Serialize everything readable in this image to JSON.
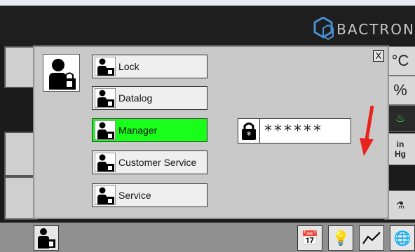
{
  "header": {
    "brand": "BACTRON"
  },
  "right_panel": {
    "temp_unit": "°C",
    "humidity_unit": "%",
    "pressure_unit_line1": "in",
    "pressure_unit_line2": "Hg"
  },
  "login": {
    "close_label": "X",
    "menu": [
      {
        "label": "Lock",
        "icon": "lock-user-icon",
        "active": false
      },
      {
        "label": "Datalog",
        "icon": "datalog-user-icon",
        "active": false
      },
      {
        "label": "Manager",
        "icon": "manager-user-icon",
        "active": true
      },
      {
        "label": "Customer Service",
        "icon": "customer-service-user-icon",
        "active": false
      },
      {
        "label": "Service",
        "icon": "service-user-icon",
        "active": false
      }
    ],
    "password_value": "******"
  },
  "colors": {
    "active": "#19ff19",
    "arrow": "#e8231c"
  }
}
